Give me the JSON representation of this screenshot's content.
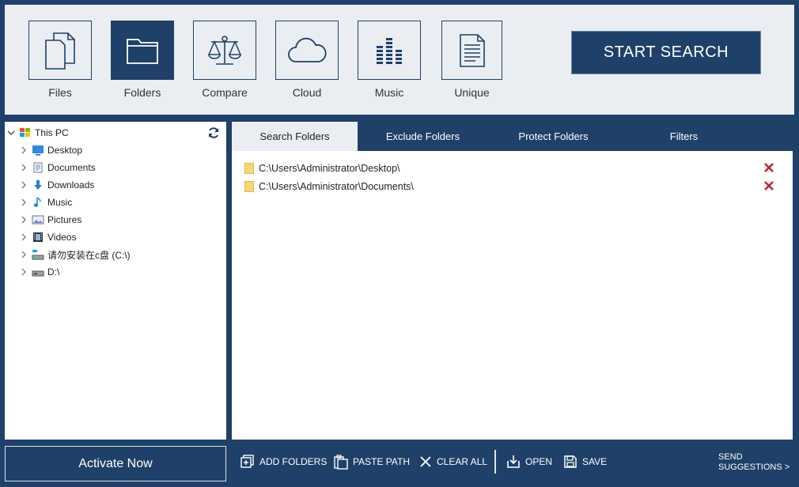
{
  "modes": [
    {
      "label": "Files",
      "icon": "files-icon"
    },
    {
      "label": "Folders",
      "icon": "folder-icon",
      "active": true
    },
    {
      "label": "Compare",
      "icon": "scales-icon"
    },
    {
      "label": "Cloud",
      "icon": "cloud-icon"
    },
    {
      "label": "Music",
      "icon": "equalizer-icon"
    },
    {
      "label": "Unique",
      "icon": "document-icon"
    }
  ],
  "start_button": "START SEARCH",
  "tree": {
    "root": "This PC",
    "items": [
      {
        "label": "Desktop",
        "icon": "desktop-icon"
      },
      {
        "label": "Documents",
        "icon": "documents-icon"
      },
      {
        "label": "Downloads",
        "icon": "download-arrow-icon"
      },
      {
        "label": "Music",
        "icon": "music-note-icon"
      },
      {
        "label": "Pictures",
        "icon": "pictures-icon"
      },
      {
        "label": "Videos",
        "icon": "film-icon"
      },
      {
        "label": "请勿安装在c盘 (C:\\)",
        "icon": "drive-c-icon"
      },
      {
        "label": "D:\\",
        "icon": "drive-icon"
      }
    ]
  },
  "tabs": [
    "Search Folders",
    "Exclude Folders",
    "Protect Folders",
    "Filters"
  ],
  "folders": [
    "C:\\Users\\Administrator\\Desktop\\",
    "C:\\Users\\Administrator\\Documents\\"
  ],
  "bottom": {
    "activate": "Activate Now",
    "add_folders": "ADD FOLDERS",
    "paste_path": "PASTE PATH",
    "clear_all": "CLEAR ALL",
    "open": "OPEN",
    "save": "SAVE",
    "suggest_line1": "SEND",
    "suggest_line2": "SUGGESTIONS >"
  },
  "colors": {
    "primary": "#1f4068",
    "panel": "#eaeef3",
    "delete": "#c0202a"
  }
}
